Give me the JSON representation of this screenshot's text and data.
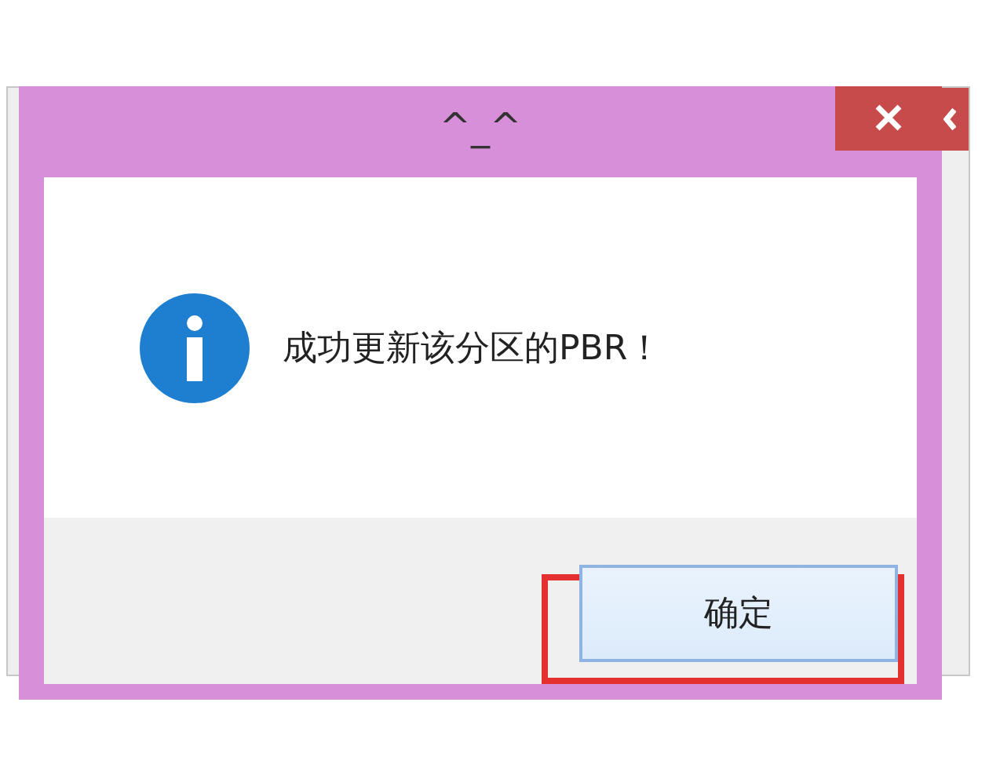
{
  "dialog": {
    "title": "^_^",
    "message": "成功更新该分区的PBR！",
    "buttons": [
      {
        "label": "确定",
        "highlighted": true
      }
    ]
  }
}
